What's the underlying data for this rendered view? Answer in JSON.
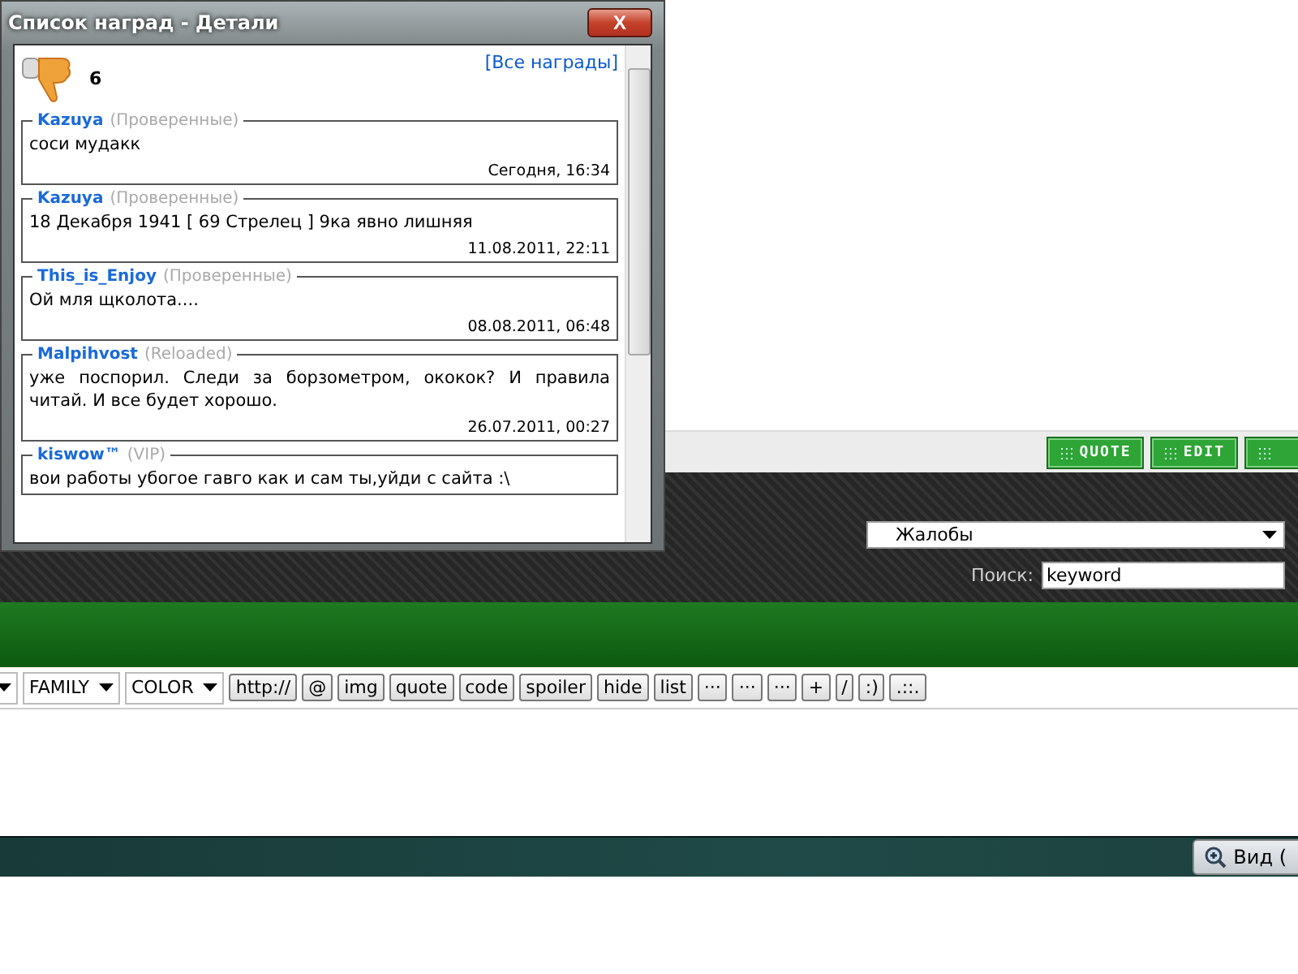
{
  "popup": {
    "title": "Список наград - Детали",
    "close_label": "X",
    "count": "6",
    "all_link": "[Все награды]",
    "comments": [
      {
        "author": "Kazuya",
        "group": "(Проверенные)",
        "text": "соси мудакк",
        "date": "Сегодня, 16:34"
      },
      {
        "author": "Kazuya",
        "group": "(Проверенные)",
        "text": "18 Декабря 1941 [ 69 Стрелец ] 9ка явно лишняя",
        "date": "11.08.2011, 22:11"
      },
      {
        "author": "This_is_Enjoy",
        "group": "(Проверенные)",
        "text": "Ой мля щколота....",
        "date": "08.08.2011, 06:48"
      },
      {
        "author": "Malpihvost",
        "group": "(Reloaded)",
        "text": "уже поспорил. Следи за борзометром, ококок? И правила читай. И все будет хорошо.",
        "date": "26.07.2011, 00:27"
      },
      {
        "author": "kiswow™",
        "group": "(VIP)",
        "text": "вои работы убогое гавго как и сам ты,уйди с сайта :\\"
      }
    ]
  },
  "post_buttons": [
    {
      "label": "QUOTE"
    },
    {
      "label": "EDIT"
    }
  ],
  "forum_select": {
    "value": "Жалобы"
  },
  "search": {
    "label": "Поиск:",
    "value": "keyword"
  },
  "editor_toolbar": {
    "selects": [
      {
        "value": "FAMILY"
      },
      {
        "value": "COLOR"
      }
    ],
    "buttons": [
      "http://",
      "@",
      "img",
      "quote",
      "code",
      "spoiler",
      "hide",
      "list",
      "···",
      "···",
      "···",
      "+",
      "/",
      ":)",
      ".::."
    ]
  },
  "taskbar": {
    "button": "Вид ("
  }
}
